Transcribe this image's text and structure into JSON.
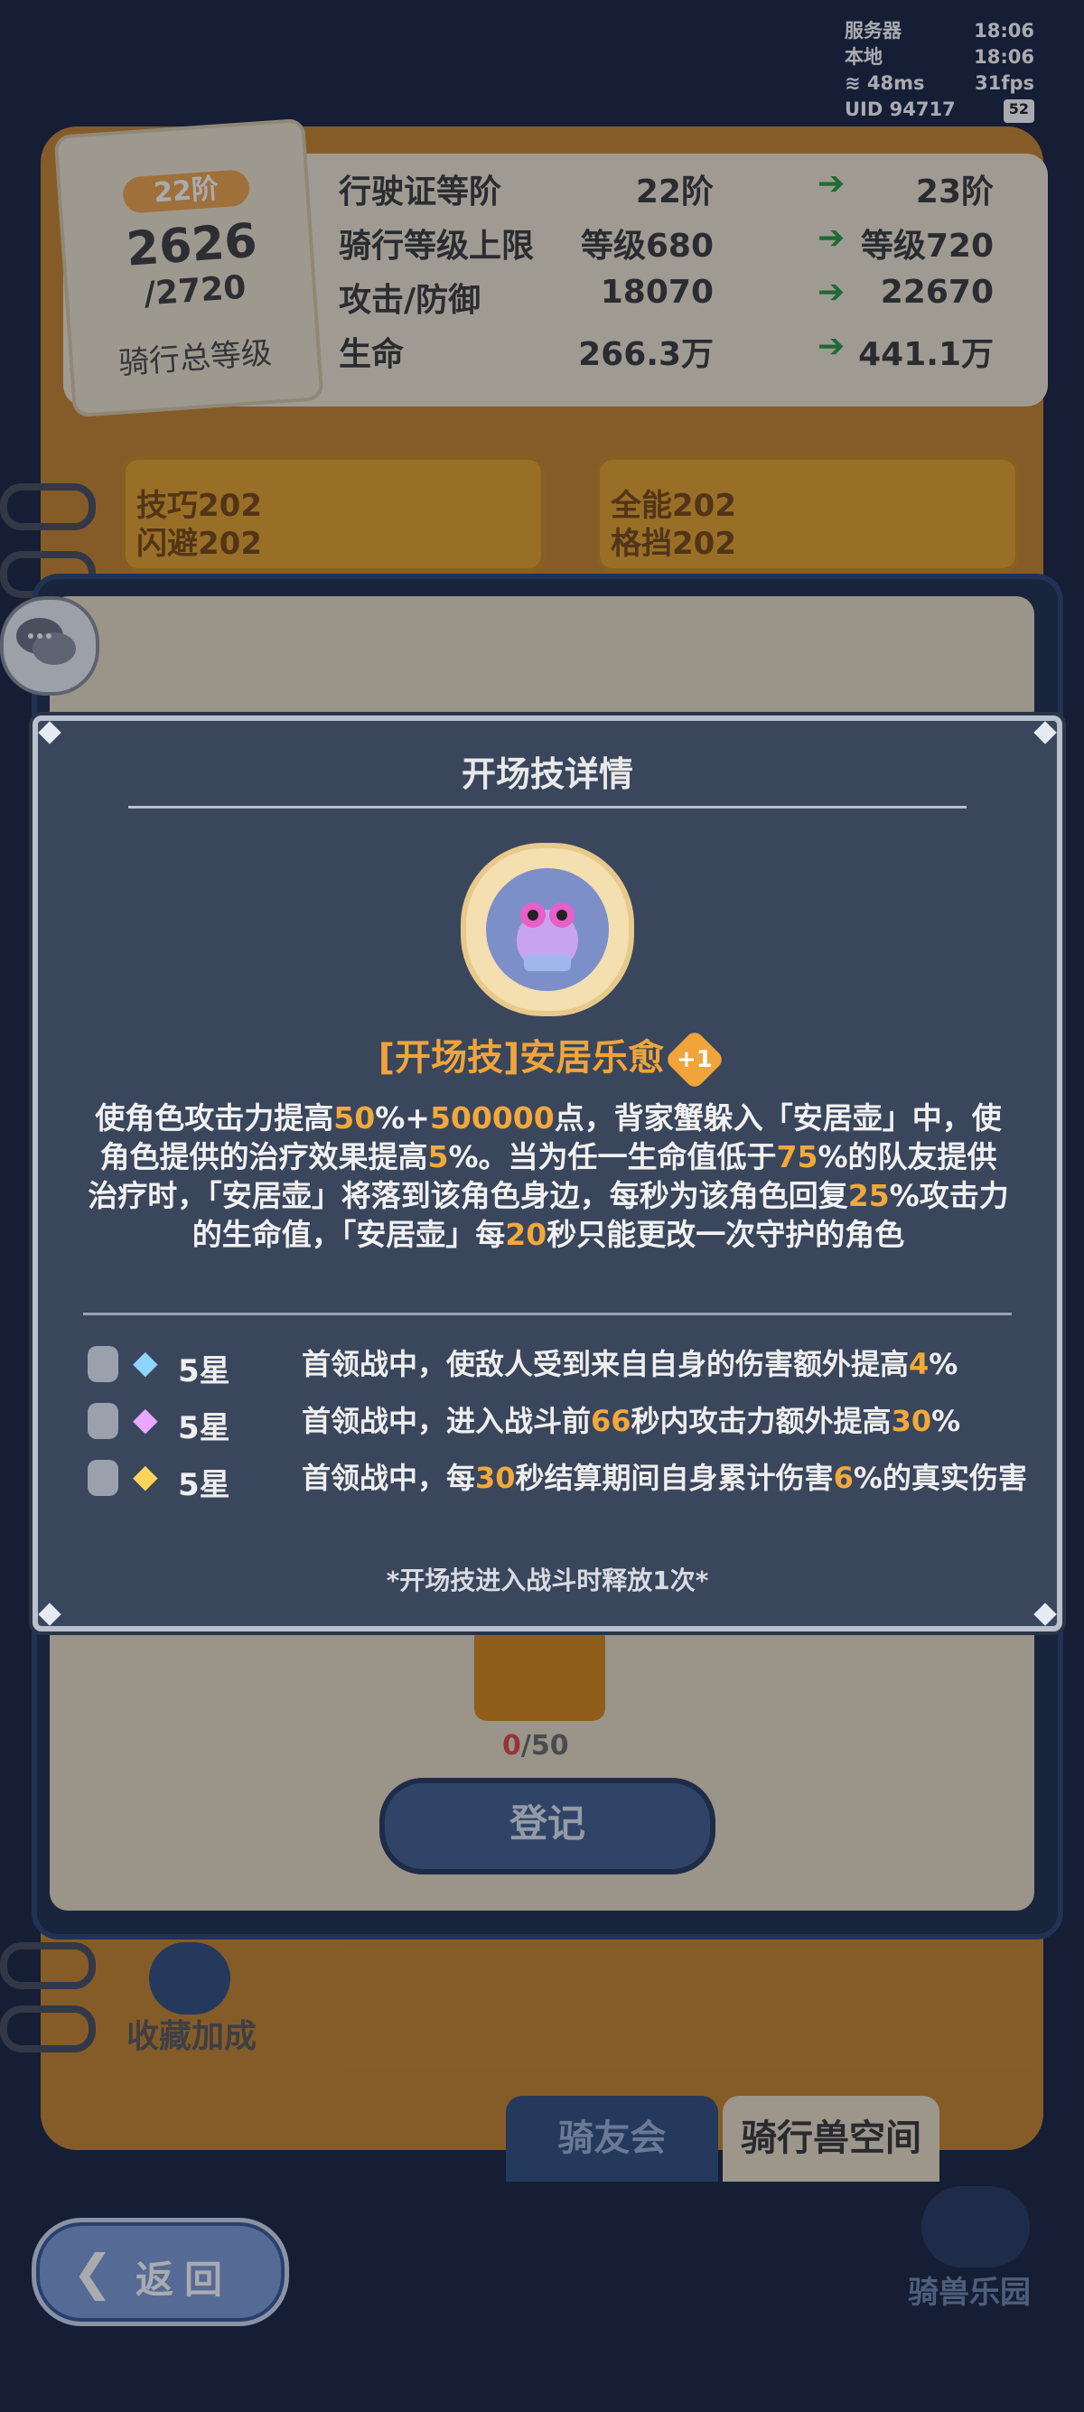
{
  "status": {
    "server_label": "服务器",
    "server_time": "18:06",
    "local_label": "本地",
    "local_time": "18:06",
    "ping": "48ms",
    "fps": "31fps",
    "uid": "UID 94717",
    "battery": "52"
  },
  "level": {
    "tier": "22阶",
    "total": "2626",
    "max": "/2720",
    "label": "骑行总等级"
  },
  "stats": [
    {
      "label": "行驶证等阶",
      "current": "22阶",
      "next": "23阶"
    },
    {
      "label": "骑行等级上限",
      "current": "等级680",
      "next": "等级720"
    },
    {
      "label": "攻击/防御",
      "current": "18070",
      "next": "22670"
    },
    {
      "label": "生命",
      "current": "266.3万",
      "next": "441.1万"
    }
  ],
  "stubs": [
    {
      "line1": "技巧202",
      "line2": "闪避202"
    },
    {
      "line1": "全能202",
      "line2": "格挡202"
    }
  ],
  "background": {
    "progress_value": "0",
    "progress_total": "/50",
    "register": "登记",
    "collect_bonus": "收藏加成",
    "tab_club": "骑友会",
    "tab_space": "骑行兽空间",
    "park": "骑兽乐园",
    "back": "返回"
  },
  "dialog": {
    "title": "开场技详情",
    "skill_name": "[开场技]安居乐愈",
    "plus": "+1",
    "desc": [
      {
        "t": "使角色攻击力提高"
      },
      {
        "h": "50"
      },
      {
        "t": "%+"
      },
      {
        "h": "500000"
      },
      {
        "t": "点，背家蟹躲入「安居壶」中，使角色提供的治疗效果提高"
      },
      {
        "h": "5"
      },
      {
        "t": "%。当为任一生命值低于"
      },
      {
        "h": "75"
      },
      {
        "t": "%的队友提供治疗时，「安居壶」将落到该角色身边，每秒为该角色回复"
      },
      {
        "h": "25"
      },
      {
        "t": "%攻击力的生命值，「安居壶」每"
      },
      {
        "h": "20"
      },
      {
        "t": "秒只能更改一次守护的角色"
      }
    ],
    "stars": [
      {
        "gem": "◆",
        "gem_color": "#8fd3ff",
        "count": "5星",
        "text": [
          {
            "t": "首领战中，使敌人受到来自自身的伤害额外提高"
          },
          {
            "h": "4"
          },
          {
            "t": "%"
          }
        ]
      },
      {
        "gem": "◆",
        "gem_color": "#e8a8ff",
        "count": "5星",
        "text": [
          {
            "t": "首领战中，进入战斗前"
          },
          {
            "h": "66"
          },
          {
            "t": "秒内攻击力额外提高"
          },
          {
            "h": "30"
          },
          {
            "t": "%"
          }
        ]
      },
      {
        "gem": "◆",
        "gem_color": "#ffd45a",
        "count": "5星",
        "text": [
          {
            "t": "首领战中，每"
          },
          {
            "h": "30"
          },
          {
            "t": "秒结算期间自身累计伤害"
          },
          {
            "h": "6"
          },
          {
            "t": "%的真实伤害"
          }
        ]
      }
    ],
    "footer": "*开场技进入战斗时释放1次*"
  }
}
